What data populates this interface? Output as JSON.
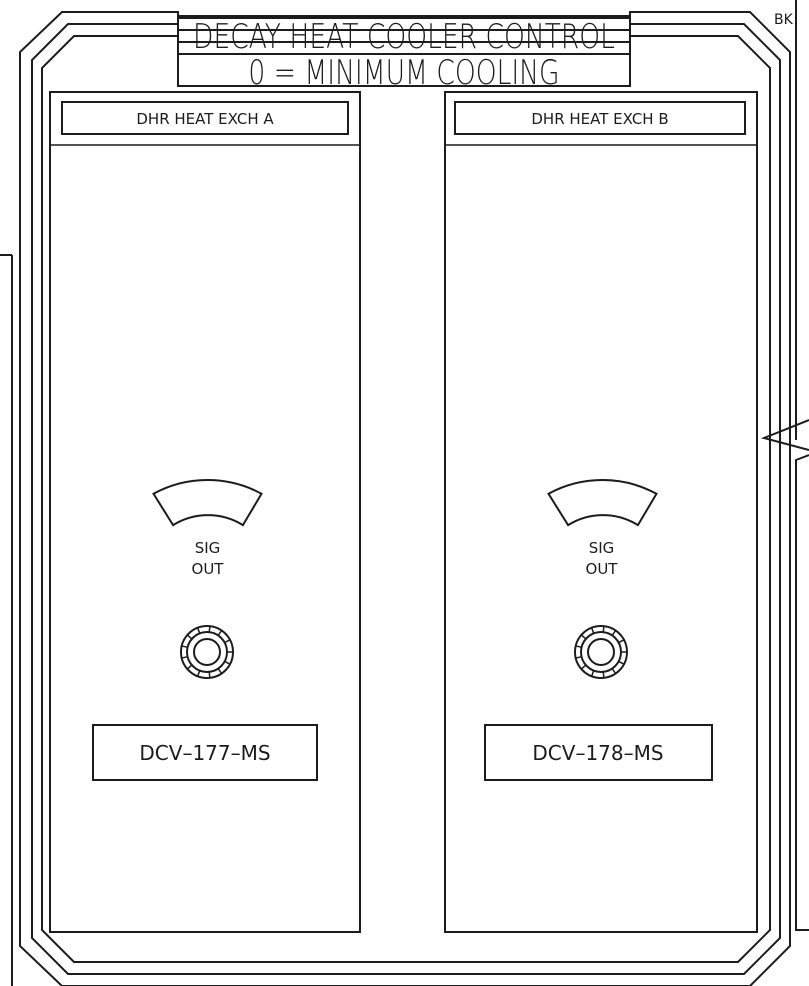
{
  "corner_tag": "BK",
  "title": {
    "line1": "DECAY HEAT COOLER CONTROL",
    "line2": "0 = MINIMUM COOLING"
  },
  "sections": [
    {
      "header": "DHR HEAT EXCH A",
      "indicator_label_line1": "SIG",
      "indicator_label_line2": "OUT",
      "tag": "DCV–177–MS"
    },
    {
      "header": "DHR HEAT EXCH B",
      "indicator_label_line1": "SIG",
      "indicator_label_line2": "OUT",
      "tag": "DCV–178–MS"
    }
  ],
  "colors": {
    "line": "#1c1c1c",
    "background": "#ffffff"
  }
}
